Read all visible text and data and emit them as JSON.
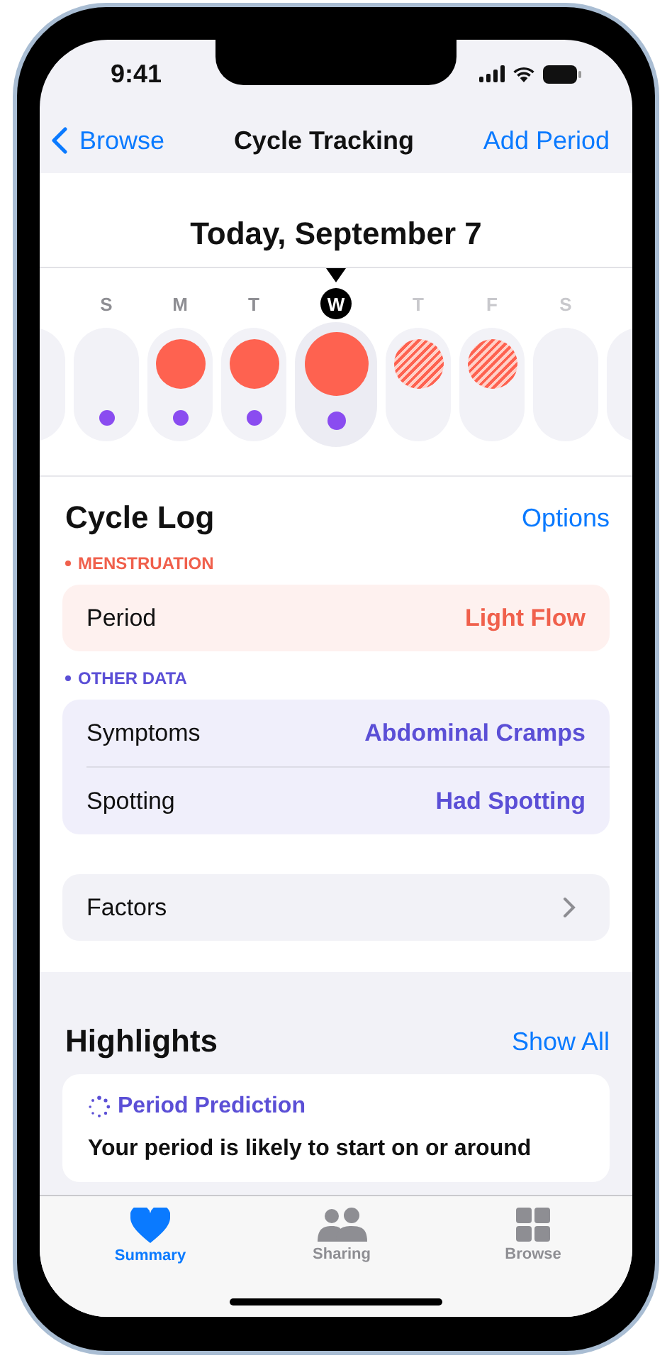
{
  "status_bar": {
    "time": "9:41"
  },
  "nav": {
    "back": "Browse",
    "title": "Cycle Tracking",
    "action": "Add Period"
  },
  "date_title": "Today, September 7",
  "days": [
    {
      "letter": "S",
      "selected": false,
      "future": false,
      "period_logged": false,
      "period_predicted": false,
      "other_data": true
    },
    {
      "letter": "M",
      "selected": false,
      "future": false,
      "period_logged": true,
      "period_predicted": false,
      "other_data": true
    },
    {
      "letter": "T",
      "selected": false,
      "future": false,
      "period_logged": true,
      "period_predicted": false,
      "other_data": true
    },
    {
      "letter": "W",
      "selected": true,
      "future": false,
      "period_logged": true,
      "period_predicted": false,
      "other_data": true
    },
    {
      "letter": "T",
      "selected": false,
      "future": true,
      "period_logged": false,
      "period_predicted": true,
      "other_data": false
    },
    {
      "letter": "F",
      "selected": false,
      "future": true,
      "period_logged": false,
      "period_predicted": true,
      "other_data": false
    },
    {
      "letter": "S",
      "selected": false,
      "future": true,
      "period_logged": false,
      "period_predicted": false,
      "other_data": false
    }
  ],
  "cycle_log": {
    "title": "Cycle Log",
    "action": "Options",
    "groups": [
      {
        "label": "MENSTRUATION",
        "color": "#f0604c",
        "rows": [
          {
            "label": "Period",
            "value": "Light Flow"
          }
        ]
      },
      {
        "label": "OTHER DATA",
        "color": "#5b4fd6",
        "rows": [
          {
            "label": "Symptoms",
            "value": "Abdominal Cramps"
          },
          {
            "label": "Spotting",
            "value": "Had Spotting"
          }
        ]
      }
    ],
    "factors": "Factors"
  },
  "highlights": {
    "title": "Highlights",
    "action": "Show All",
    "card_title": "Period Prediction",
    "card_text": "Your period is likely to start on or around"
  },
  "tabs": [
    {
      "label": "Summary",
      "selected": true
    },
    {
      "label": "Sharing",
      "selected": false
    },
    {
      "label": "Browse",
      "selected": false
    }
  ]
}
